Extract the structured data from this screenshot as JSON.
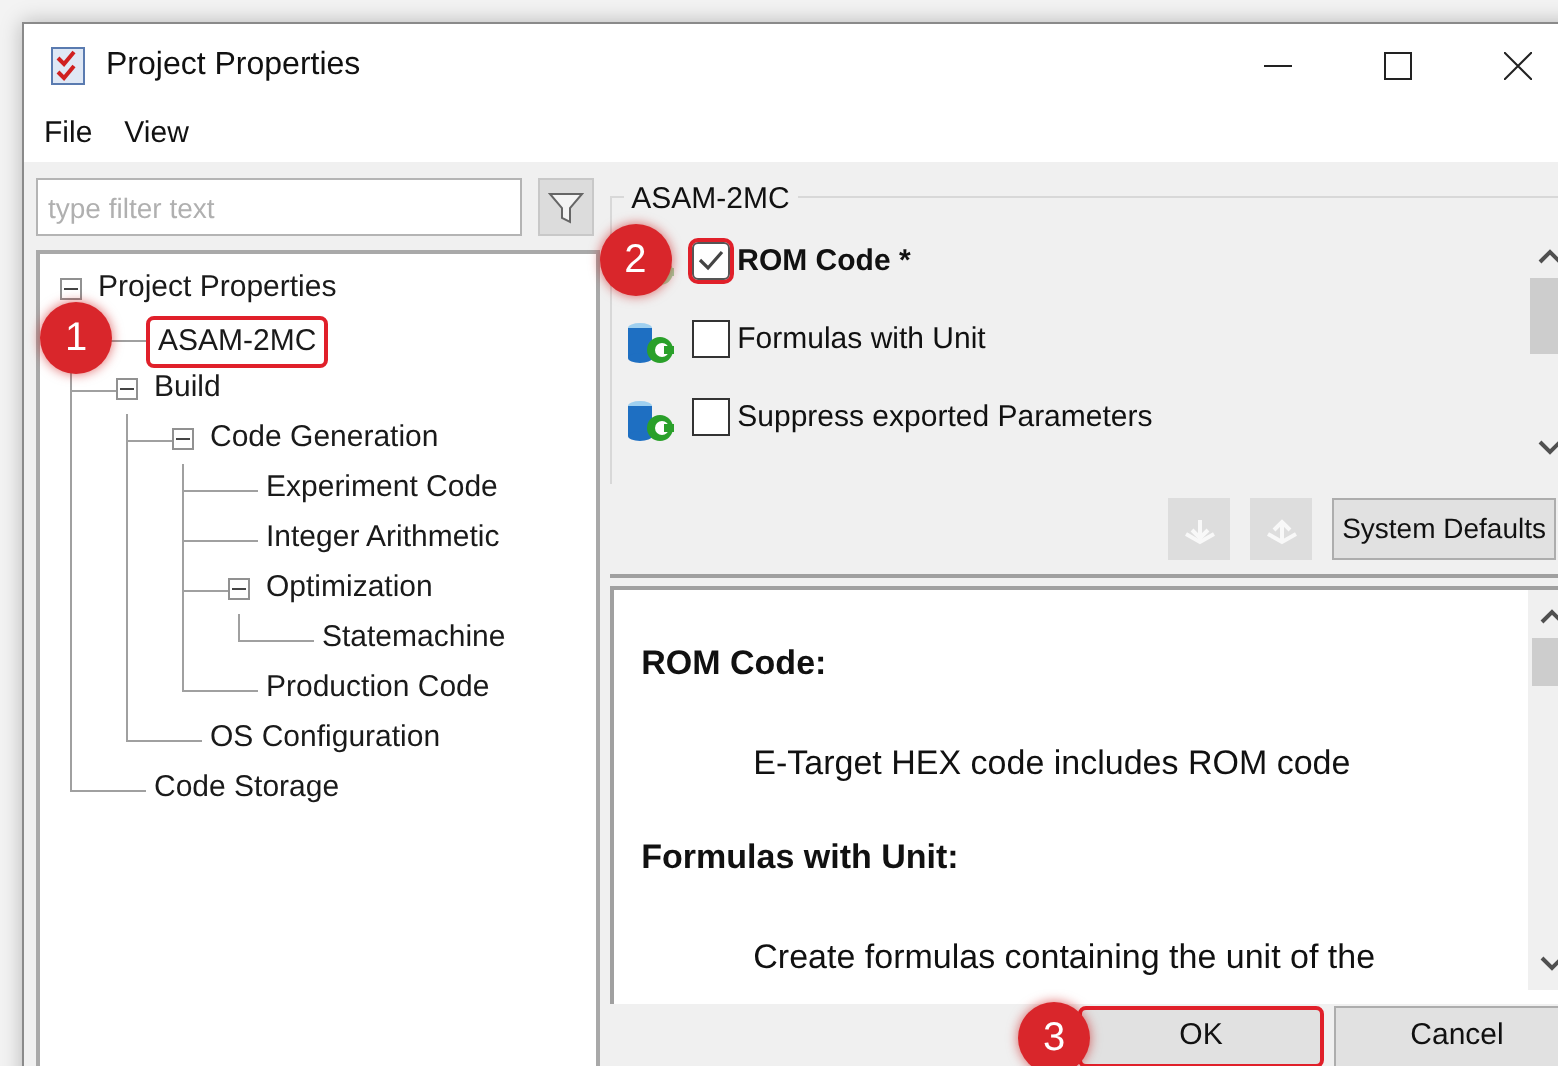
{
  "window": {
    "title": "Project Properties"
  },
  "menu": [
    "File",
    "View"
  ],
  "filter": {
    "placeholder": "type filter text"
  },
  "tree": [
    {
      "label": "Project Properties",
      "expanded": true,
      "children": [
        {
          "label": "ASAM-2MC",
          "highlighted": true,
          "badge": "1"
        },
        {
          "label": "Build",
          "expanded": true,
          "children": [
            {
              "label": "Code Generation",
              "expanded": true,
              "children": [
                {
                  "label": "Experiment Code"
                },
                {
                  "label": "Integer Arithmetic"
                },
                {
                  "label": "Optimization",
                  "expanded": true,
                  "children": [
                    {
                      "label": "Statemachine"
                    }
                  ]
                },
                {
                  "label": "Production Code"
                }
              ]
            },
            {
              "label": "OS Configuration"
            }
          ]
        },
        {
          "label": "Code Storage"
        }
      ]
    }
  ],
  "group": {
    "title": "ASAM-2MC",
    "options": [
      {
        "label": "ROM Code *",
        "checked": true,
        "changed": true,
        "highlighted": true,
        "badge": "2"
      },
      {
        "label": "Formulas with Unit",
        "checked": false,
        "changed": false
      },
      {
        "label": "Suppress exported Parameters",
        "checked": false,
        "changed": false
      }
    ]
  },
  "toolbar": {
    "icon_buttons": [
      {
        "kind": "import",
        "disabled": true
      },
      {
        "kind": "export",
        "disabled": true
      }
    ],
    "defaults_button": "System Defaults"
  },
  "help": [
    {
      "heading": "ROM Code:",
      "body": "E-Target HEX code includes ROM code"
    },
    {
      "heading": "Formulas with Unit:",
      "body": "Create formulas containing the unit of the"
    }
  ],
  "buttons": [
    {
      "label": "OK",
      "highlighted": true,
      "badge": "3"
    },
    {
      "label": "Cancel"
    }
  ]
}
